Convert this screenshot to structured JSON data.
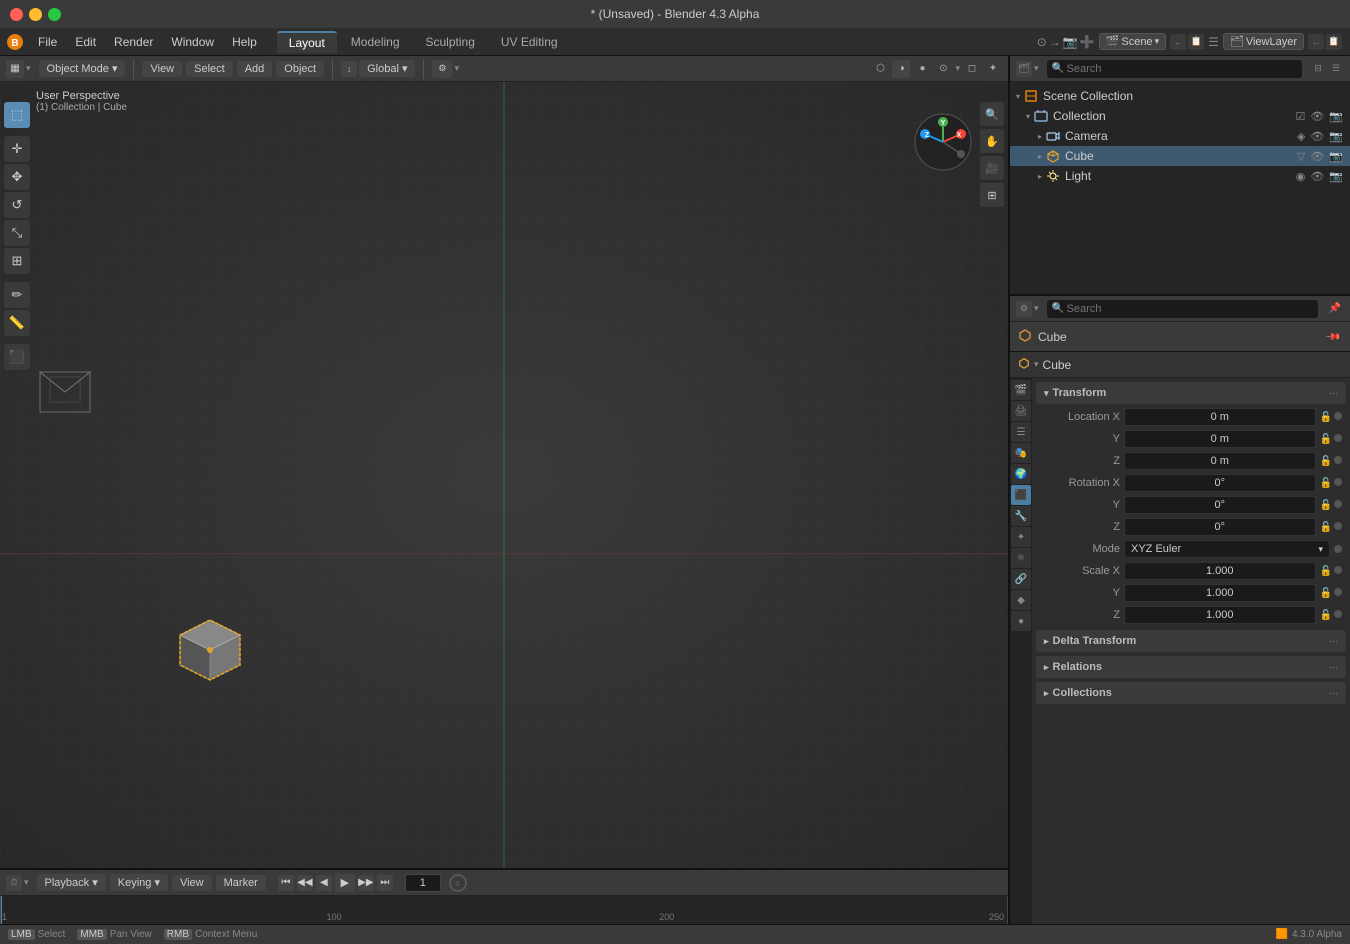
{
  "titlebar": {
    "title": "* (Unsaved) - Blender 4.3 Alpha"
  },
  "menubar": {
    "items": [
      "Blender",
      "File",
      "Edit",
      "Render",
      "Window",
      "Help"
    ]
  },
  "workspace_tabs": {
    "tabs": [
      "Layout",
      "Modeling",
      "Sculpting",
      "UV Editing"
    ],
    "active": "Layout"
  },
  "header_toolbar": {
    "mode_label": "Object Mode",
    "view_label": "View",
    "select_label": "Select",
    "add_label": "Add",
    "object_label": "Object",
    "transform_label": "Global",
    "scene_label": "Scene",
    "viewlayer_label": "ViewLayer"
  },
  "viewport": {
    "perspective_label": "User Perspective",
    "collection_label": "(1) Collection | Cube"
  },
  "outliner": {
    "search_placeholder": "Search",
    "items": [
      {
        "id": "scene-collection",
        "label": "Scene Collection",
        "level": 0,
        "icon": "scene",
        "expanded": true
      },
      {
        "id": "collection",
        "label": "Collection",
        "level": 1,
        "icon": "collection",
        "expanded": true
      },
      {
        "id": "camera",
        "label": "Camera",
        "level": 2,
        "icon": "camera"
      },
      {
        "id": "cube",
        "label": "Cube",
        "level": 2,
        "icon": "cube",
        "active": true
      },
      {
        "id": "light",
        "label": "Light",
        "level": 2,
        "icon": "light"
      }
    ]
  },
  "properties": {
    "search_placeholder": "Search",
    "object_name": "Cube",
    "object_breadcrumb": "Cube",
    "sections": {
      "transform": {
        "label": "Transform",
        "location": {
          "x": "0 m",
          "y": "0 m",
          "z": "0 m"
        },
        "rotation": {
          "x": "0°",
          "y": "0°",
          "z": "0°"
        },
        "mode": "XYZ Euler",
        "scale": {
          "x": "1.000",
          "y": "1.000",
          "z": "1.000"
        }
      },
      "delta_transform": {
        "label": "Delta Transform",
        "collapsed": true
      },
      "relations": {
        "label": "Relations",
        "collapsed": true
      },
      "collections": {
        "label": "Collections",
        "collapsed": true
      }
    },
    "sidebar_icons": [
      "render",
      "output",
      "view-layer",
      "scene",
      "world",
      "object",
      "modifier",
      "particles",
      "physics",
      "constraints",
      "data",
      "material",
      "shaderfx"
    ]
  },
  "timeline": {
    "playback_label": "Playback",
    "keying_label": "Keying",
    "view_label": "View",
    "marker_label": "Marker",
    "frame_start": "1",
    "frame_end": "250",
    "current_frame": "1",
    "ruler_marks": [
      "1",
      "100",
      "200",
      "250"
    ]
  },
  "statusbar": {
    "select_label": "Select",
    "pan_label": "Pan View",
    "context_label": "Context Menu",
    "version": "4.3.0 Alpha"
  }
}
